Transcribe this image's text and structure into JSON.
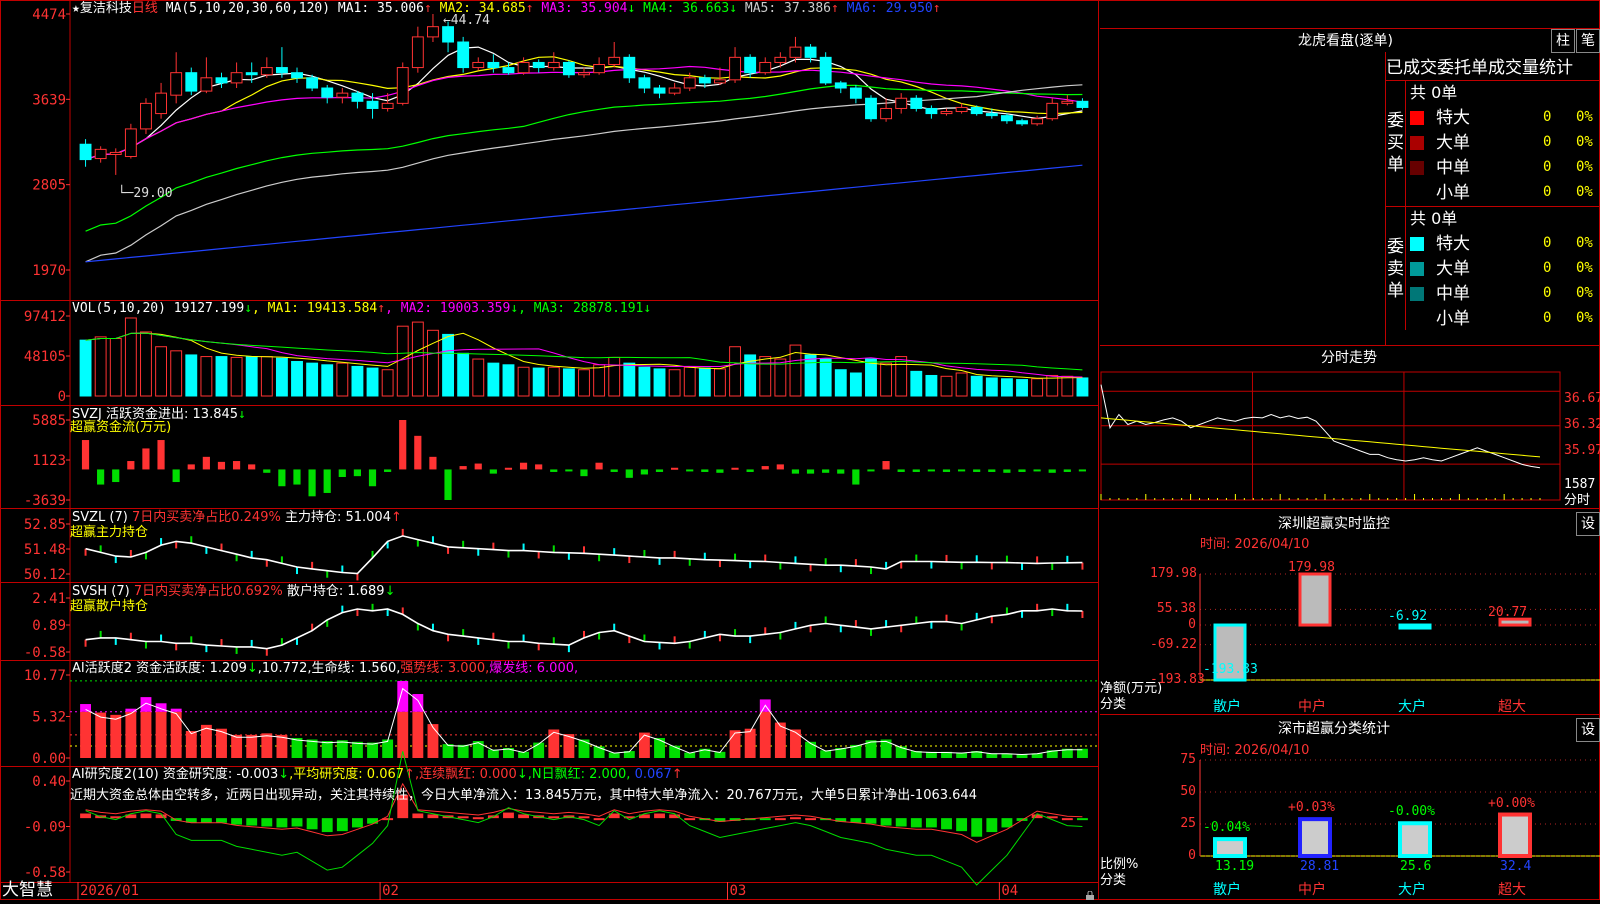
{
  "stock": {
    "star": "★",
    "name": "复洁科技",
    "period": "日线"
  },
  "ma_header": {
    "params": "MA(5,10,20,30,60,120)",
    "items": [
      {
        "label": "MA1:",
        "value": "35.006",
        "arrow": "↑",
        "color": "#ffffff"
      },
      {
        "label": "MA2:",
        "value": "34.685",
        "arrow": "↑",
        "color": "#ffff00"
      },
      {
        "label": "MA3:",
        "value": "35.904",
        "arrow": "↓",
        "color": "#ff00ff"
      },
      {
        "label": "MA4:",
        "value": "36.663",
        "arrow": "↓",
        "color": "#00ff00"
      },
      {
        "label": "MA5:",
        "value": "37.386",
        "arrow": "↑",
        "color": "#cccccc"
      },
      {
        "label": "MA6:",
        "value": "29.950",
        "arrow": "↑",
        "color": "#2244ff"
      }
    ]
  },
  "price_axis": [
    "4474",
    "3639",
    "2805",
    "1970"
  ],
  "price_annotations": {
    "high": "44.74",
    "low": "29.00"
  },
  "vol_header": {
    "params": "VOL(5,10,20)",
    "value": "19127.199",
    "arrow": "↓",
    "items": [
      {
        "label": "MA1:",
        "value": "19413.584",
        "arrow": "↑",
        "color": "#ffff00"
      },
      {
        "label": "MA2:",
        "value": "19003.359",
        "arrow": "↓",
        "color": "#ff00ff"
      },
      {
        "label": "MA3:",
        "value": "28878.191",
        "arrow": "↓",
        "color": "#00ff00"
      }
    ]
  },
  "vol_axis": [
    "97412",
    "48105",
    "0"
  ],
  "svzj": {
    "title": "SVZJ  活跃资金进出: 13.845",
    "arrow": "↓",
    "sub": "超赢资金流(万元)",
    "axis": [
      "5885",
      "1123",
      "-3639"
    ]
  },
  "svzl": {
    "title": "SVZL (7) ",
    "red": "7日内买卖净占比0.249%",
    "mid": " 主力持仓: 51.004",
    "arrow": "↑",
    "sub": "超赢主力持仓",
    "axis": [
      "52.85",
      "51.48",
      "50.12"
    ]
  },
  "svsh": {
    "title": "SVSH (7) ",
    "red": "7日内买卖净占比0.692%",
    "mid": " 散户持仓: 1.689",
    "arrow": "↓",
    "sub": "超赢散户持仓",
    "axis": [
      "2.41",
      "0.89",
      "-0.58"
    ]
  },
  "ai1": {
    "t1": "AI活跃度2 资金活跃度: 1.209",
    "a1": "↓",
    "t2": ",10.772,生命线: 1.560,",
    "t3": "强势线: 3.000,",
    "t4": "爆发线: 6.000,",
    "axis": [
      "10.77",
      "5.32",
      "0.00"
    ]
  },
  "ai2": {
    "t1": "AI研究度2(10) 资金研究度: -0.003",
    "a1": "↓",
    "t2": ",平均研究度: 0.067",
    "a2": "↑",
    "t3": ",连续飘红: 0.000",
    "a3": "↓",
    "t4": ",N日飘红: 2.000,",
    "t5": " 0.067",
    "a5": "↑",
    "comment": "近期大资金总体由空转多，近两日出现异动，关注其持续性，今日大单净流入：13.845万元，其中特大单净流入：20.767万元，大单5日累计净出-1063.644",
    "axis": [
      "0.40",
      "-0.09",
      "-0.58"
    ]
  },
  "date_axis": [
    {
      "label": "2026/01"
    },
    {
      "label": "02"
    },
    {
      "label": "03"
    },
    {
      "label": "04"
    }
  ],
  "brand": "大智慧",
  "right_panel": {
    "title": "龙虎看盘(逐单)",
    "btn1": "柱",
    "btn2": "笔",
    "tabs": "已成交委托单成交量统计",
    "buy": {
      "side": "委买单",
      "total": "共 0单",
      "rows": [
        {
          "label": "特大",
          "v": "0",
          "p": "0%",
          "color": "#ff0000"
        },
        {
          "label": "大单",
          "v": "0",
          "p": "0%",
          "color": "#aa0000"
        },
        {
          "label": "中单",
          "v": "0",
          "p": "0%",
          "color": "#660000"
        },
        {
          "label": "小单",
          "v": "0",
          "p": "0%",
          "color": ""
        }
      ]
    },
    "sell": {
      "side": "委卖单",
      "total": "共 0单",
      "rows": [
        {
          "label": "特大",
          "v": "0",
          "p": "0%",
          "color": "#00ffff"
        },
        {
          "label": "大单",
          "v": "0",
          "p": "0%",
          "color": "#009999"
        },
        {
          "label": "中单",
          "v": "0",
          "p": "0%",
          "color": "#007777"
        },
        {
          "label": "小单",
          "v": "0",
          "p": "0%",
          "color": ""
        }
      ]
    }
  },
  "intraday": {
    "title": "分时走势",
    "axis": [
      "36.67",
      "36.32",
      "35.97",
      "1587"
    ],
    "unit": "分时"
  },
  "sz_monitor": {
    "title": "深圳超赢实时监控",
    "btn": "设",
    "time": "时间: 2026/04/10",
    "axis": [
      "179.98",
      "55.38",
      "0",
      "-69.22",
      "-193.83"
    ],
    "ylabel1": "净额(万元)",
    "ylabel2": "分类"
  },
  "sz_class": {
    "title": "深市超赢分类统计",
    "btn": "设",
    "time": "时间: 2026/04/10",
    "axis": [
      "75",
      "50",
      "25",
      "0"
    ],
    "ylabel1": "比例%",
    "ylabel2": "分类"
  },
  "colors": {
    "up": "#ff3333",
    "down": "#00ffff",
    "border": "#c00000"
  },
  "chart_data": [
    {
      "type": "candlestick",
      "title": "复洁科技 日线",
      "series_name": "K线",
      "ylim": [
        19.7,
        44.74
      ],
      "candles": [
        [
          32.0,
          30.5,
          32.5,
          29.8
        ],
        [
          30.6,
          31.5,
          31.8,
          30.2
        ],
        [
          31.0,
          31.2,
          31.6,
          29.0
        ],
        [
          30.8,
          33.5,
          34.0,
          30.6
        ],
        [
          33.5,
          36.0,
          36.5,
          33.0
        ],
        [
          35.0,
          37.0,
          38.0,
          34.5
        ],
        [
          36.8,
          39.0,
          41.0,
          36.0
        ],
        [
          39.0,
          37.2,
          39.5,
          36.8
        ],
        [
          37.2,
          38.5,
          40.5,
          37.0
        ],
        [
          38.5,
          38.0,
          39.0,
          37.5
        ],
        [
          38.0,
          39.0,
          40.0,
          37.5
        ],
        [
          39.0,
          38.8,
          40.0,
          38.0
        ],
        [
          38.8,
          39.5,
          40.5,
          38.5
        ],
        [
          39.5,
          39.0,
          41.5,
          38.5
        ],
        [
          39.0,
          38.5,
          39.5,
          38.0
        ],
        [
          38.5,
          37.5,
          38.8,
          37.2
        ],
        [
          37.5,
          36.6,
          37.8,
          36.0
        ],
        [
          36.6,
          37.0,
          37.5,
          36.0
        ],
        [
          37.0,
          36.2,
          37.2,
          35.5
        ],
        [
          36.2,
          35.5,
          37.0,
          34.5
        ],
        [
          35.5,
          36.0,
          37.0,
          35.2
        ],
        [
          36.0,
          39.5,
          40.0,
          35.8
        ],
        [
          39.5,
          42.5,
          43.5,
          39.0
        ],
        [
          42.5,
          43.5,
          44.74,
          42.0
        ],
        [
          43.5,
          42.0,
          44.0,
          41.0
        ],
        [
          42.0,
          39.5,
          42.5,
          39.0
        ],
        [
          39.5,
          40.0,
          40.5,
          39.2
        ],
        [
          40.0,
          39.5,
          40.8,
          39.0
        ],
        [
          39.5,
          39.0,
          40.0,
          38.8
        ],
        [
          39.0,
          40.0,
          40.5,
          38.8
        ],
        [
          40.0,
          39.5,
          40.3,
          39.0
        ],
        [
          39.5,
          40.0,
          41.0,
          39.2
        ],
        [
          40.0,
          38.8,
          40.2,
          38.5
        ],
        [
          38.8,
          39.0,
          39.5,
          38.5
        ],
        [
          39.0,
          39.8,
          40.5,
          38.8
        ],
        [
          39.8,
          40.5,
          42.0,
          39.5
        ],
        [
          40.5,
          38.5,
          40.8,
          38.0
        ],
        [
          38.5,
          37.5,
          38.8,
          37.0
        ],
        [
          37.5,
          37.0,
          37.8,
          36.5
        ],
        [
          37.0,
          37.5,
          38.0,
          36.8
        ],
        [
          37.5,
          38.5,
          39.0,
          37.2
        ],
        [
          38.5,
          38.0,
          38.8,
          37.5
        ],
        [
          38.0,
          38.3,
          39.5,
          37.8
        ],
        [
          38.3,
          40.5,
          41.5,
          38.0
        ],
        [
          40.5,
          39.0,
          40.8,
          38.5
        ],
        [
          39.0,
          40.0,
          40.5,
          38.8
        ],
        [
          40.0,
          40.5,
          41.0,
          39.5
        ],
        [
          40.5,
          41.5,
          42.5,
          40.0
        ],
        [
          41.5,
          40.5,
          41.8,
          40.0
        ],
        [
          40.5,
          38.0,
          41.0,
          37.8
        ],
        [
          38.0,
          37.5,
          38.2,
          37.0
        ],
        [
          37.5,
          36.5,
          37.8,
          36.0
        ],
        [
          36.5,
          34.5,
          36.8,
          34.2
        ],
        [
          34.5,
          35.5,
          36.5,
          34.2
        ],
        [
          35.5,
          36.5,
          37.0,
          35.0
        ],
        [
          36.5,
          35.5,
          36.8,
          35.2
        ],
        [
          35.5,
          35.0,
          35.8,
          34.5
        ],
        [
          35.0,
          35.2,
          35.5,
          34.8
        ],
        [
          35.2,
          35.6,
          36.0,
          35.0
        ],
        [
          35.6,
          35.0,
          35.8,
          34.8
        ],
        [
          35.0,
          34.8,
          35.5,
          34.5
        ],
        [
          34.8,
          34.3,
          35.0,
          34.0
        ],
        [
          34.3,
          34.0,
          34.5,
          33.8
        ],
        [
          34.0,
          34.5,
          34.8,
          33.8
        ],
        [
          34.5,
          36.0,
          36.5,
          34.3
        ],
        [
          36.0,
          36.2,
          36.8,
          35.8
        ],
        [
          36.2,
          35.6,
          36.5,
          35.4
        ]
      ]
    },
    {
      "type": "bar",
      "title": "VOL(5,10,20)",
      "ylim": [
        0,
        97412
      ],
      "values": [
        68000,
        72000,
        70000,
        95000,
        78000,
        60000,
        55000,
        50000,
        48000,
        48000,
        47000,
        48000,
        48000,
        46000,
        42000,
        40000,
        38000,
        40000,
        36000,
        34000,
        32000,
        85000,
        90000,
        80000,
        75000,
        52000,
        45000,
        40000,
        38000,
        35000,
        34000,
        35000,
        33000,
        32000,
        38000,
        47000,
        40000,
        35000,
        33000,
        32000,
        35000,
        34000,
        33000,
        60000,
        50000,
        48000,
        45000,
        62000,
        50000,
        45000,
        32000,
        28000,
        45000,
        40000,
        48000,
        30000,
        25000,
        24000,
        28000,
        24000,
        22000,
        21000,
        20000,
        21000,
        25000,
        24000,
        22000
      ],
      "series": [
        {
          "name": "MA1",
          "color": "#ffff00"
        },
        {
          "name": "MA2",
          "color": "#ff00ff"
        },
        {
          "name": "MA3",
          "color": "#00ff00"
        }
      ]
    },
    {
      "type": "bar",
      "title": "超赢资金流(万元)",
      "ylim": [
        -3639,
        5885
      ],
      "values": [
        3500,
        -1800,
        -1500,
        1000,
        2500,
        3500,
        -1500,
        600,
        1500,
        900,
        1000,
        600,
        -400,
        -2000,
        -1800,
        -3200,
        -2800,
        -900,
        -800,
        -2000,
        -300,
        5885,
        4000,
        1500,
        -3639,
        400,
        700,
        -500,
        200,
        800,
        600,
        -300,
        -100,
        -800,
        800,
        -300,
        -1000,
        -600,
        -300,
        200,
        -200,
        -300,
        -400,
        200,
        -300,
        400,
        600,
        -500,
        -500,
        -400,
        -500,
        -1800,
        -100,
        1000,
        -300,
        -300,
        -200,
        -300,
        -200,
        -300,
        -300,
        -400,
        -300,
        -200,
        -400,
        -300,
        -200
      ]
    },
    {
      "type": "line",
      "title": "超赢主力持仓",
      "ylim": [
        50.12,
        52.85
      ],
      "values": [
        51.5,
        51.3,
        51.1,
        51.05,
        51.3,
        51.7,
        51.9,
        51.8,
        51.6,
        51.4,
        51.2,
        51.0,
        50.9,
        50.7,
        50.5,
        50.4,
        50.3,
        50.2,
        50.15,
        51.0,
        51.9,
        52.2,
        52.0,
        51.8,
        51.6,
        51.55,
        51.5,
        51.45,
        51.4,
        51.4,
        51.35,
        51.3,
        51.28,
        51.25,
        51.2,
        51.15,
        51.1,
        51.05,
        51.0,
        51.0,
        50.95,
        50.9,
        50.88,
        50.85,
        50.82,
        50.8,
        50.75,
        50.7,
        50.65,
        50.6,
        50.6,
        50.55,
        50.5,
        50.4,
        50.8,
        50.8,
        50.8,
        50.78,
        50.76,
        50.76,
        50.75,
        50.74,
        50.72,
        50.7,
        50.72,
        50.73,
        50.74
      ]
    },
    {
      "type": "line",
      "title": "超赢散户持仓",
      "ylim": [
        -0.58,
        2.41
      ],
      "values": [
        0.1,
        0.2,
        0.2,
        0.1,
        0.0,
        0.0,
        -0.1,
        -0.1,
        -0.2,
        -0.25,
        -0.3,
        -0.3,
        -0.4,
        -0.2,
        0.2,
        0.6,
        1.2,
        1.6,
        1.8,
        1.7,
        1.8,
        1.5,
        1.0,
        0.6,
        0.4,
        0.3,
        0.2,
        0.1,
        0.0,
        0.0,
        -0.1,
        -0.15,
        -0.2,
        0.2,
        0.5,
        0.6,
        0.3,
        0.0,
        -0.05,
        -0.1,
        0.0,
        0.2,
        0.4,
        0.3,
        0.3,
        0.4,
        0.5,
        0.7,
        0.9,
        1.0,
        0.9,
        0.8,
        0.7,
        0.8,
        0.9,
        1.0,
        1.1,
        1.1,
        1.0,
        1.2,
        1.4,
        1.5,
        1.7,
        1.7,
        1.8,
        1.7,
        1.69
      ]
    },
    {
      "type": "bar",
      "title": "AI活跃度2",
      "ylim": [
        0,
        10.77
      ],
      "values": [
        7.0,
        5.9,
        5.6,
        6.4,
        7.9,
        7.1,
        6.4,
        3.5,
        4.3,
        3.8,
        3.0,
        3.0,
        3.2,
        3.0,
        2.6,
        2.4,
        2.2,
        2.3,
        2.1,
        2.0,
        2.4,
        10.0,
        8.3,
        4.4,
        1.8,
        1.7,
        2.2,
        1.1,
        1.3,
        0.8,
        2.0,
        3.7,
        3.1,
        2.4,
        1.5,
        0.7,
        0.9,
        3.3,
        2.6,
        1.6,
        0.7,
        1.2,
        0.8,
        3.6,
        3.8,
        7.6,
        4.6,
        3.7,
        2.1,
        1.0,
        1.3,
        1.7,
        2.3,
        2.4,
        1.5,
        0.9,
        0.8,
        0.8,
        0.7,
        0.9,
        0.6,
        0.6,
        0.5,
        0.6,
        1.0,
        1.2,
        1.2
      ]
    },
    {
      "type": "bar",
      "title": "AI研究度2(10)",
      "ylim": [
        -0.58,
        0.4
      ],
      "values": [
        0.05,
        0.03,
        0.02,
        0.04,
        0.05,
        0.04,
        -0.03,
        -0.05,
        -0.05,
        -0.05,
        -0.07,
        -0.08,
        -0.09,
        -0.1,
        -0.09,
        -0.12,
        -0.15,
        -0.14,
        -0.1,
        -0.06,
        0.0,
        0.25,
        0.05,
        0.04,
        0.03,
        0.02,
        0.01,
        0.03,
        0.06,
        0.04,
        0.03,
        0.02,
        0.03,
        0.02,
        0.0,
        0.05,
        0.02,
        0.04,
        0.05,
        0.04,
        0.0,
        -0.02,
        -0.04,
        -0.03,
        -0.02,
        -0.01,
        0.0,
        0.01,
        0.0,
        -0.02,
        -0.04,
        -0.05,
        -0.06,
        -0.08,
        -0.09,
        -0.1,
        -0.1,
        -0.12,
        -0.14,
        -0.2,
        -0.15,
        -0.1,
        -0.03,
        0.04,
        0.02,
        0.0,
        -0.003
      ]
    },
    {
      "type": "line",
      "title": "分时走势",
      "ylim": [
        35.62,
        37.02
      ],
      "values": [
        36.95,
        36.3,
        36.5,
        36.35,
        36.4,
        36.35,
        36.38,
        36.42,
        36.45,
        36.4,
        36.3,
        36.35,
        36.4,
        36.45,
        36.42,
        36.4,
        36.44,
        36.46,
        36.45,
        36.5,
        36.45,
        36.48,
        36.44,
        36.46,
        36.4,
        36.25,
        36.1,
        36.05,
        36.0,
        35.95,
        35.9,
        35.9,
        35.85,
        35.82,
        35.8,
        35.82,
        35.85,
        35.82,
        35.8,
        35.85,
        35.9,
        35.95,
        36.0,
        35.95,
        35.9,
        35.85,
        35.8,
        35.75,
        35.72,
        35.7
      ]
    },
    {
      "type": "bar",
      "title": "深圳超赢实时监控",
      "ylim": [
        -193.83,
        179.98
      ],
      "categories": [
        "散户",
        "中户",
        "大户",
        "超大"
      ],
      "values": [
        -193.83,
        179.98,
        -6.92,
        20.77
      ]
    },
    {
      "type": "bar",
      "title": "深市超赢分类统计",
      "ylim": [
        0,
        75
      ],
      "categories": [
        "散户",
        "中户",
        "大户",
        "超大"
      ],
      "values": [
        13.19,
        28.81,
        25.6,
        32.4
      ],
      "changes": [
        "-0.04%",
        "+0.03%",
        "-0.00%",
        "+0.00%"
      ]
    }
  ]
}
